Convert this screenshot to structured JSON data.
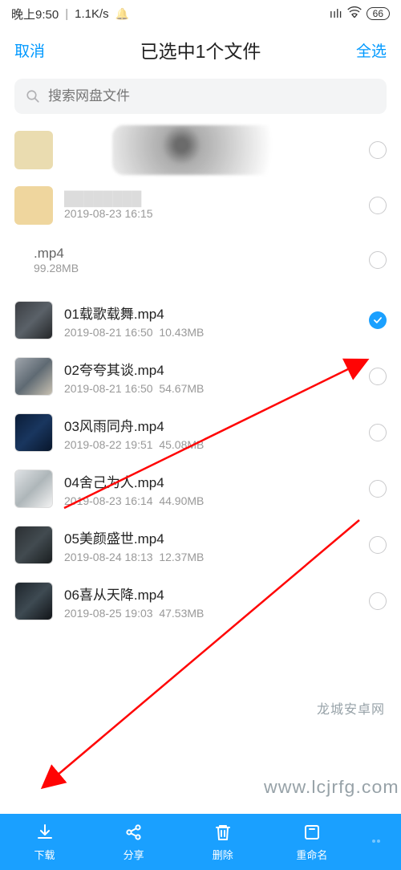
{
  "status_bar": {
    "time": "晚上9:50",
    "net_speed": "1.1K/s",
    "battery": "66"
  },
  "header": {
    "cancel": "取消",
    "title": "已选中1个文件",
    "select_all": "全选"
  },
  "search": {
    "placeholder": "搜索网盘文件"
  },
  "obscured": {
    "date_a": "2019-08-23  16:15",
    "name_b_suffix": ".mp4",
    "size_b": "99.28MB"
  },
  "files": [
    {
      "name": "01载歌载舞.mp4",
      "date": "2019-08-21  16:50",
      "size": "10.43MB",
      "checked": true
    },
    {
      "name": "02夸夸其谈.mp4",
      "date": "2019-08-21  16:50",
      "size": "54.67MB",
      "checked": false
    },
    {
      "name": "03风雨同舟.mp4",
      "date": "2019-08-22  19:51",
      "size": "45.08MB",
      "checked": false
    },
    {
      "name": "04舍己为人.mp4",
      "date": "2019-08-23  16:14",
      "size": "44.90MB",
      "checked": false
    },
    {
      "name": "05美颜盛世.mp4",
      "date": "2019-08-24  18:13",
      "size": "12.37MB",
      "checked": false
    },
    {
      "name": "06喜从天降.mp4",
      "date": "2019-08-25  19:03",
      "size": "47.53MB",
      "checked": false
    }
  ],
  "bottom_bar": {
    "download": "下载",
    "share": "分享",
    "delete": "删除",
    "rename": "重命名"
  },
  "watermarks": {
    "w1": "龙城安卓网",
    "w2": "www.lcjrfg.com"
  }
}
